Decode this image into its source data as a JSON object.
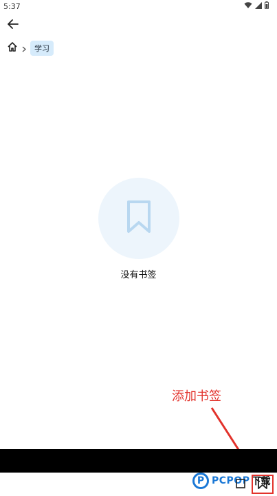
{
  "status_bar": {
    "time": "5:37",
    "icons": [
      "wifi-icon",
      "signal-icon",
      "battery-icon"
    ]
  },
  "nav": {
    "back_icon": "arrow-left-icon",
    "breadcrumb": {
      "home_icon": "home-icon",
      "separator_icon": "chevron-right-icon",
      "current": "学习"
    }
  },
  "empty_state": {
    "icon": "bookmark-icon",
    "message": "没有书签"
  },
  "annotation": {
    "label": "添加书签"
  },
  "watermark": {
    "logo_letter": "P",
    "brand": "PCPOP",
    "suffix": "下载"
  },
  "bottom_bar": {
    "icons": [
      "window-icon",
      "bookmark-add-icon"
    ]
  },
  "colors": {
    "accent": "#1a78d6",
    "chip_bg": "#d6ebfb",
    "empty_circle": "#edf5fc",
    "annotation_red": "#e2322b"
  }
}
